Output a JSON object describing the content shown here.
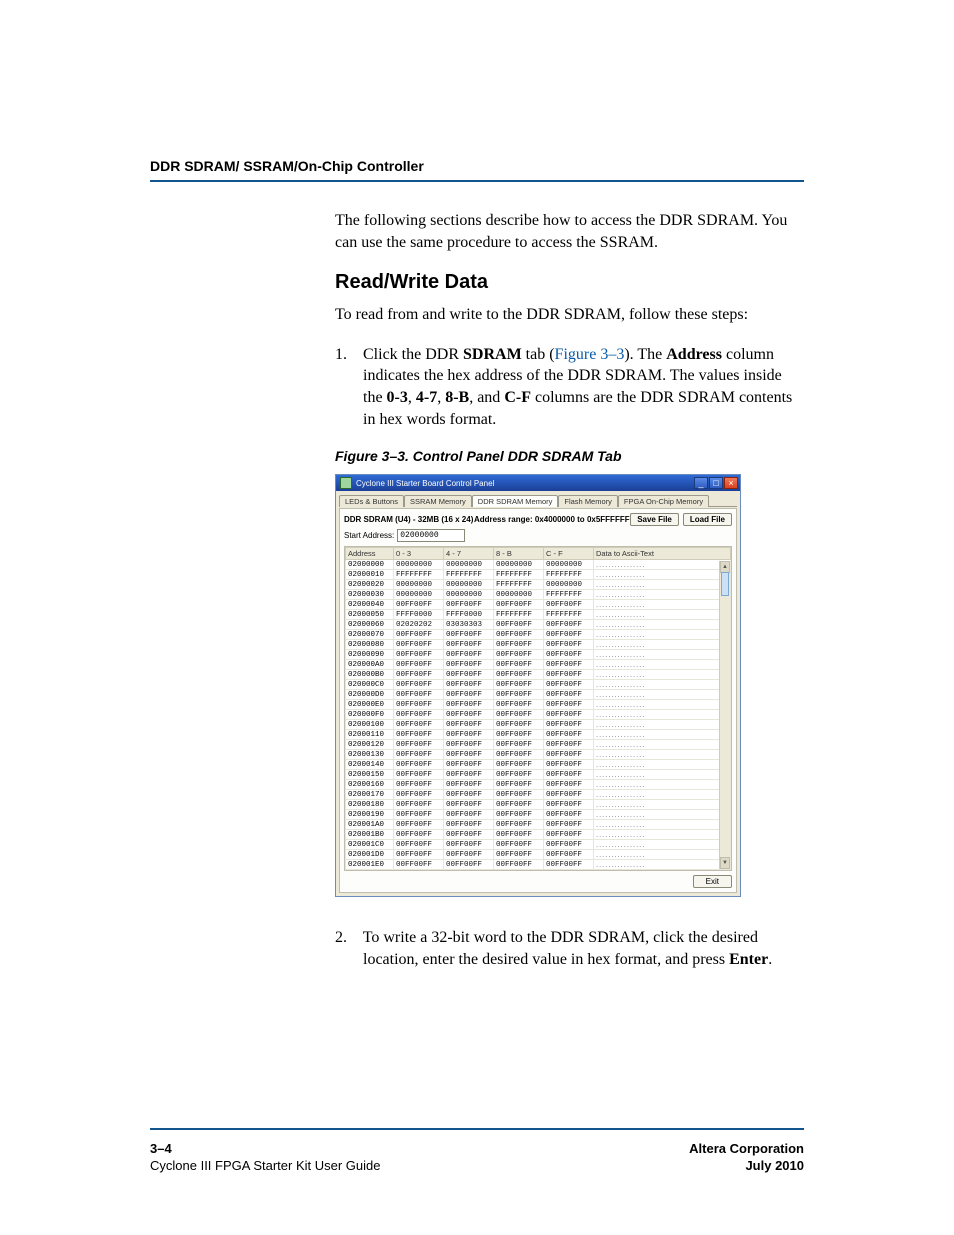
{
  "runningHead": "DDR SDRAM/ SSRAM/On-Chip Controller",
  "intro": "The following sections describe how to access the DDR SDRAM. You can use the same procedure to access the SSRAM.",
  "h3": "Read/Write Data",
  "p1": "To read from and write to the DDR SDRAM, follow these steps:",
  "step1": {
    "num": "1.",
    "pre": "Click the DDR ",
    "bold1": "SDRAM",
    "mid1": " tab (",
    "link": "Figure 3–3",
    "mid2": "). The ",
    "bold2": "Address",
    "mid3": " column indicates the hex address of the DDR SDRAM. The values inside the ",
    "bold3": "0-3",
    "c1": ", ",
    "bold4": "4-7",
    "c2": ", ",
    "bold5": "8-B",
    "c3": ", and ",
    "bold6": "C-F",
    "tail": " columns are the DDR SDRAM contents in hex words format."
  },
  "figCaption": "Figure 3–3. Control Panel DDR SDRAM Tab",
  "app": {
    "title": "Cyclone III Starter Board Control Panel",
    "tabs": [
      "LEDs & Buttons",
      "SSRAM Memory",
      "DDR SDRAM Memory",
      "Flash Memory",
      "FPGA On-Chip Memory"
    ],
    "activeTab": 2,
    "infoLeft": "DDR SDRAM (U4) - 32MB (16 x 24)",
    "rangeLabel": "Address range:",
    "rangeFrom": "0x4000000",
    "rangeTo": "to",
    "rangeEnd": "0x5FFFFFF",
    "saveFile": "Save File",
    "loadFile": "Load File",
    "startLabel": "Start Address:",
    "startValue": "02000000",
    "cols": [
      "Address",
      "0 - 3",
      "4 - 7",
      "8 - B",
      "C - F",
      "Data to Ascii-Text"
    ],
    "rows": [
      {
        "a": "02000000",
        "c": [
          "00000000",
          "00000000",
          "00000000",
          "00000000"
        ],
        "t": "................"
      },
      {
        "a": "02000010",
        "c": [
          "FFFFFFFF",
          "FFFFFFFF",
          "FFFFFFFF",
          "FFFFFFFF"
        ],
        "t": "................"
      },
      {
        "a": "02000020",
        "c": [
          "00000000",
          "00000000",
          "FFFFFFFF",
          "00000000"
        ],
        "t": "................"
      },
      {
        "a": "02000030",
        "c": [
          "00000000",
          "00000000",
          "00000000",
          "FFFFFFFF"
        ],
        "t": "................"
      },
      {
        "a": "02000040",
        "c": [
          "00FF00FF",
          "00FF00FF",
          "00FF00FF",
          "00FF00FF"
        ],
        "t": "................"
      },
      {
        "a": "02000050",
        "c": [
          "FFFF0000",
          "FFFF0000",
          "FFFFFFFF",
          "FFFFFFFF"
        ],
        "t": "................"
      },
      {
        "a": "02000060",
        "c": [
          "02020202",
          "03030303",
          "00FF00FF",
          "00FF00FF"
        ],
        "t": "................"
      },
      {
        "a": "02000070",
        "c": [
          "00FF00FF",
          "00FF00FF",
          "00FF00FF",
          "00FF00FF"
        ],
        "t": "................"
      },
      {
        "a": "02000080",
        "c": [
          "00FF00FF",
          "00FF00FF",
          "00FF00FF",
          "00FF00FF"
        ],
        "t": "................"
      },
      {
        "a": "02000090",
        "c": [
          "00FF00FF",
          "00FF00FF",
          "00FF00FF",
          "00FF00FF"
        ],
        "t": "................"
      },
      {
        "a": "020000A0",
        "c": [
          "00FF00FF",
          "00FF00FF",
          "00FF00FF",
          "00FF00FF"
        ],
        "t": "................"
      },
      {
        "a": "020000B0",
        "c": [
          "00FF00FF",
          "00FF00FF",
          "00FF00FF",
          "00FF00FF"
        ],
        "t": "................"
      },
      {
        "a": "020000C0",
        "c": [
          "00FF00FF",
          "00FF00FF",
          "00FF00FF",
          "00FF00FF"
        ],
        "t": "................"
      },
      {
        "a": "020000D0",
        "c": [
          "00FF00FF",
          "00FF00FF",
          "00FF00FF",
          "00FF00FF"
        ],
        "t": "................"
      },
      {
        "a": "020000E0",
        "c": [
          "00FF00FF",
          "00FF00FF",
          "00FF00FF",
          "00FF00FF"
        ],
        "t": "................"
      },
      {
        "a": "020000F0",
        "c": [
          "00FF00FF",
          "00FF00FF",
          "00FF00FF",
          "00FF00FF"
        ],
        "t": "................"
      },
      {
        "a": "02000100",
        "c": [
          "00FF00FF",
          "00FF00FF",
          "00FF00FF",
          "00FF00FF"
        ],
        "t": "................"
      },
      {
        "a": "02000110",
        "c": [
          "00FF00FF",
          "00FF00FF",
          "00FF00FF",
          "00FF00FF"
        ],
        "t": "................"
      },
      {
        "a": "02000120",
        "c": [
          "00FF00FF",
          "00FF00FF",
          "00FF00FF",
          "00FF00FF"
        ],
        "t": "................"
      },
      {
        "a": "02000130",
        "c": [
          "00FF00FF",
          "00FF00FF",
          "00FF00FF",
          "00FF00FF"
        ],
        "t": "................"
      },
      {
        "a": "02000140",
        "c": [
          "00FF00FF",
          "00FF00FF",
          "00FF00FF",
          "00FF00FF"
        ],
        "t": "................"
      },
      {
        "a": "02000150",
        "c": [
          "00FF00FF",
          "00FF00FF",
          "00FF00FF",
          "00FF00FF"
        ],
        "t": "................"
      },
      {
        "a": "02000160",
        "c": [
          "00FF00FF",
          "00FF00FF",
          "00FF00FF",
          "00FF00FF"
        ],
        "t": "................"
      },
      {
        "a": "02000170",
        "c": [
          "00FF00FF",
          "00FF00FF",
          "00FF00FF",
          "00FF00FF"
        ],
        "t": "................"
      },
      {
        "a": "02000180",
        "c": [
          "00FF00FF",
          "00FF00FF",
          "00FF00FF",
          "00FF00FF"
        ],
        "t": "................"
      },
      {
        "a": "02000190",
        "c": [
          "00FF00FF",
          "00FF00FF",
          "00FF00FF",
          "00FF00FF"
        ],
        "t": "................"
      },
      {
        "a": "020001A0",
        "c": [
          "00FF00FF",
          "00FF00FF",
          "00FF00FF",
          "00FF00FF"
        ],
        "t": "................"
      },
      {
        "a": "020001B0",
        "c": [
          "00FF00FF",
          "00FF00FF",
          "00FF00FF",
          "00FF00FF"
        ],
        "t": "................"
      },
      {
        "a": "020001C0",
        "c": [
          "00FF00FF",
          "00FF00FF",
          "00FF00FF",
          "00FF00FF"
        ],
        "t": "................"
      },
      {
        "a": "020001D0",
        "c": [
          "00FF00FF",
          "00FF00FF",
          "00FF00FF",
          "00FF00FF"
        ],
        "t": "................"
      },
      {
        "a": "020001E0",
        "c": [
          "00FF00FF",
          "00FF00FF",
          "00FF00FF",
          "00FF00FF"
        ],
        "t": "................"
      }
    ],
    "exit": "Exit"
  },
  "step2": {
    "num": "2.",
    "pre": "To write a 32-bit word to the DDR SDRAM, click the desired location, enter the desired value in hex format, and press ",
    "bold": "Enter",
    "tail": "."
  },
  "footer": {
    "pageNum": "3–4",
    "guide": "Cyclone III FPGA Starter Kit User Guide",
    "corp": "Altera Corporation",
    "date": "July 2010"
  }
}
